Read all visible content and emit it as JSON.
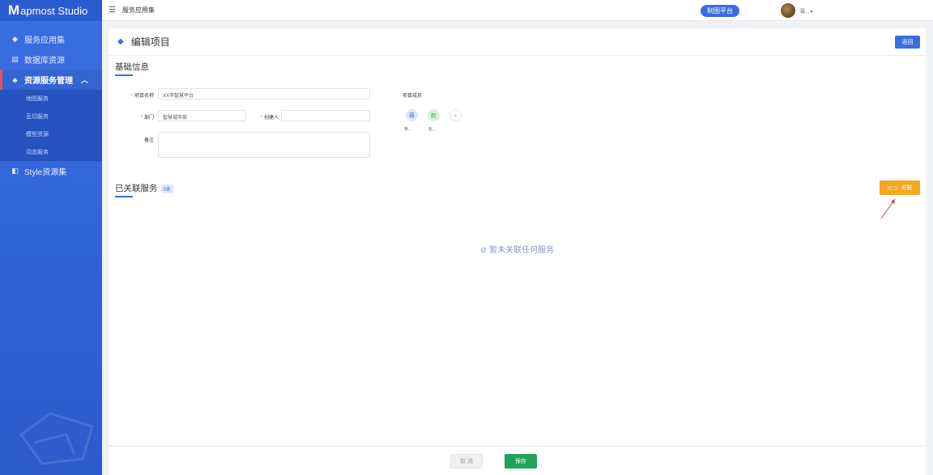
{
  "app": {
    "logo_letter": "M",
    "logo_text": "apmost Studio"
  },
  "sidebar": {
    "items": [
      {
        "label": "服务应用集",
        "icon": "layers-icon"
      },
      {
        "label": "数据库资源",
        "icon": "database-icon"
      },
      {
        "label": "资源服务管理",
        "icon": "cluster-icon",
        "caret": "︿"
      },
      {
        "label": "Style资源集",
        "icon": "style-icon"
      }
    ],
    "sub_items": [
      "地图服务",
      "瓦切服务",
      "模型资源",
      "动态服务"
    ]
  },
  "topbar": {
    "menu_icon": "☰",
    "breadcrumb": "服务应用集",
    "platform_button": "制图平台",
    "username": "聂... ▾"
  },
  "header": {
    "title": "编辑项目",
    "back_button": "返回"
  },
  "basic": {
    "section_title": "基础信息",
    "project_name_label": "项目名称",
    "project_name_value": "XX市智慧平台",
    "dept_label": "部门",
    "dept_value": "智慧城市部",
    "creator_label": "创建人",
    "creator_value": "",
    "remark_label": "备注",
    "members_label": "项目成员",
    "members": [
      {
        "avatar": "蒋",
        "name": "蒋..."
      },
      {
        "avatar": "赵",
        "name": "赵..."
      }
    ],
    "add_member": "+"
  },
  "linked": {
    "section_title": "已关联服务",
    "count": "0条",
    "link_button": "关联",
    "empty_text": "暂未关联任何服务"
  },
  "footer": {
    "cancel": "取 消",
    "save": "保存"
  },
  "colors": {
    "primary": "#3b6de0",
    "orange": "#f5a623",
    "green": "#1fa35b",
    "required": "#e74c3c"
  }
}
